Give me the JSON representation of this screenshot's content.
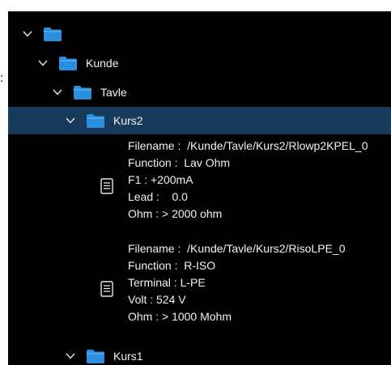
{
  "stray_label": ":",
  "tree": {
    "root": {
      "label": "",
      "icon": "folder-icon"
    },
    "kunde": {
      "label": "Kunde",
      "icon": "folder-icon"
    },
    "tavle": {
      "label": "Tavle",
      "icon": "folder-icon"
    },
    "kurs2": {
      "label": "Kurs2",
      "icon": "folder-icon",
      "selected": true
    },
    "kurs1": {
      "label": "Kurs1",
      "icon": "folder-icon"
    }
  },
  "files": [
    {
      "icon": "document-icon",
      "lines": [
        "Filename :  /Kunde/Tavle/Kurs2/Rlowp2KPEL_0",
        "Function :  Lav Ohm",
        "F1 : +200mA",
        "Lead :    0.0",
        "Ohm : > 2000 ohm"
      ]
    },
    {
      "icon": "document-icon",
      "lines": [
        "Filename :  /Kunde/Tavle/Kurs2/RisoLPE_0",
        "Function :  R-ISO",
        "Terminal : L-PE",
        "Volt : 524 V",
        "Ohm : > 1000 Mohm"
      ]
    }
  ],
  "colors": {
    "background": "#000000",
    "selected_row": "#173a5a",
    "folder": "#2b8fe0",
    "text": "#f2f2f2"
  }
}
